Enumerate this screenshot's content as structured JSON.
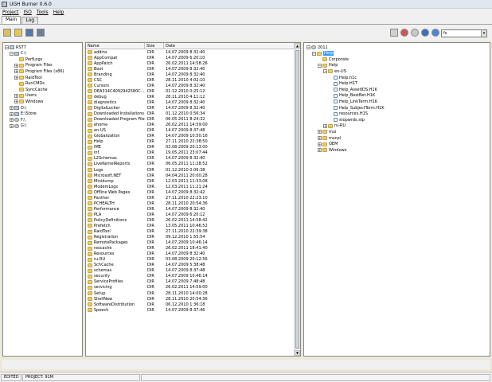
{
  "window": {
    "title": "UGH Burner 0.6.0"
  },
  "menu": [
    "Project",
    "ISO",
    "Tools",
    "Help"
  ],
  "tabs": [
    "Main",
    "Log"
  ],
  "search": {
    "value": "fs"
  },
  "left_tree": [
    {
      "label": "RST7",
      "level": 0,
      "icon": "pc-icon",
      "expander": "minus"
    },
    {
      "label": "C:\\",
      "level": 1,
      "icon": "drive-icon",
      "expander": "minus"
    },
    {
      "label": "PerfLogs",
      "level": 2,
      "icon": "folder-icon",
      "expander": "none"
    },
    {
      "label": "Program Files",
      "level": 2,
      "icon": "folder-icon",
      "expander": "plus"
    },
    {
      "label": "Program Files (x86)",
      "level": 2,
      "icon": "folder-icon",
      "expander": "plus"
    },
    {
      "label": "RaidTool",
      "level": 2,
      "icon": "folder-icon",
      "expander": "plus"
    },
    {
      "label": "RunCMDs",
      "level": 2,
      "icon": "folder-icon",
      "expander": "none"
    },
    {
      "label": "SyncCache",
      "level": 2,
      "icon": "folder-icon",
      "expander": "none"
    },
    {
      "label": "Users",
      "level": 2,
      "icon": "folder-icon",
      "expander": "plus"
    },
    {
      "label": "Windows",
      "level": 2,
      "icon": "folder-icon",
      "expander": "plus"
    },
    {
      "label": "D:\\",
      "level": 1,
      "icon": "drive-icon",
      "expander": "plus"
    },
    {
      "label": "E:\\Store",
      "level": 1,
      "icon": "drive-icon",
      "expander": "plus"
    },
    {
      "label": "F:\\",
      "level": 1,
      "icon": "disc-icon",
      "expander": "plus"
    },
    {
      "label": "G:\\",
      "level": 1,
      "icon": "disc-icon",
      "expander": "plus"
    }
  ],
  "file_list": {
    "columns": [
      "Name",
      "Size",
      "Date"
    ],
    "rows": [
      [
        "addins",
        "DIR",
        "14.07.2009 8:32:40"
      ],
      [
        "AppCompat",
        "DIR",
        "14.07.2009 6:20:10"
      ],
      [
        "AppPatch",
        "DIR",
        "26.02.2011 14:58:26"
      ],
      [
        "Boot",
        "DIR",
        "14.07.2009 8:32:40"
      ],
      [
        "Branding",
        "DIR",
        "14.07.2009 8:32:40"
      ],
      [
        "CSC",
        "DIR",
        "28.11.2010 4:02:10"
      ],
      [
        "Cursors",
        "DIR",
        "14.07.2009 8:32:40"
      ],
      [
        "DEA314C4092942580C...",
        "DIR",
        "01.12.2010 0:25:12"
      ],
      [
        "debug",
        "DIR",
        "28.11.2010 4:11:12"
      ],
      [
        "diagnostics",
        "DIR",
        "14.07.2009 8:32:40"
      ],
      [
        "DigitalLocker",
        "DIR",
        "14.07.2009 8:32:40"
      ],
      [
        "Downloaded Installations",
        "DIR",
        "01.12.2010 0:56:34"
      ],
      [
        "Downloaded Program Files",
        "DIR",
        "06.05.2011 8:24:32"
      ],
      [
        "ehome",
        "DIR",
        "26.02.2011 14:59:00"
      ],
      [
        "en-US",
        "DIR",
        "14.07.2009 8:37:48"
      ],
      [
        "Globalization",
        "DIR",
        "14.07.2009 10:50:16"
      ],
      [
        "Help",
        "DIR",
        "27.11.2010 22:38:50"
      ],
      [
        "IME",
        "DIR",
        "03.08.2009 20:13:00"
      ],
      [
        "inf",
        "DIR",
        "19.05.2011 23:07:44"
      ],
      [
        "L2Schemas",
        "DIR",
        "14.07.2009 8:32:40"
      ],
      [
        "LiveKernelReports",
        "DIR",
        "06.05.2011 11:28:52"
      ],
      [
        "Logs",
        "DIR",
        "01.12.2010 0:06:38"
      ],
      [
        "Microsoft.NET",
        "DIR",
        "04.04.2011 20:00:28"
      ],
      [
        "Minidump",
        "DIR",
        "12.03.2011 11:33:08"
      ],
      [
        "ModemLogs",
        "DIR",
        "12.03.2011 11:21:24"
      ],
      [
        "Offline Web Pages",
        "DIR",
        "14.07.2009 8:32:42"
      ],
      [
        "Panther",
        "DIR",
        "27.11.2010 22:23:10"
      ],
      [
        "PCHEALTH",
        "DIR",
        "28.11.2010 20:54:36"
      ],
      [
        "Performance",
        "DIR",
        "14.07.2009 8:32:40"
      ],
      [
        "PLA",
        "DIR",
        "14.07.2009 6:20:12"
      ],
      [
        "PolicyDefinitions",
        "DIR",
        "26.02.2011 14:58:42"
      ],
      [
        "Prefetch",
        "DIR",
        "13.05.2011 10:46:52"
      ],
      [
        "RaidTool",
        "DIR",
        "27.11.2010 22:39:38"
      ],
      [
        "Registration",
        "DIR",
        "09.12.2010 1:55:54"
      ],
      [
        "RemotePackages",
        "DIR",
        "14.07.2009 10:46:14"
      ],
      [
        "rescache",
        "DIR",
        "26.02.2011 18:41:40"
      ],
      [
        "Resources",
        "DIR",
        "14.07.2009 8:32:40"
      ],
      [
        "ru-RU",
        "DIR",
        "03.08.2009 20:12:56"
      ],
      [
        "SchCache",
        "DIR",
        "14.07.2009 5:38:48"
      ],
      [
        "schemas",
        "DIR",
        "14.07.2009 8:37:48"
      ],
      [
        "security",
        "DIR",
        "14.07.2009 10:46:14"
      ],
      [
        "ServiceProfiles",
        "DIR",
        "14.07.2009 7:48:48"
      ],
      [
        "servicing",
        "DIR",
        "26.02.2011 14:59:00"
      ],
      [
        "Setup",
        "DIR",
        "28.11.2010 14:00:28"
      ],
      [
        "ShellNew",
        "DIR",
        "28.11.2010 20:54:36"
      ],
      [
        "SoftwareDistribution",
        "DIR",
        "06.12.2010 1:36:18"
      ],
      [
        "Speech",
        "DIR",
        "14.07.2009 8:37:46"
      ]
    ]
  },
  "right_tree": [
    {
      "label": "2011",
      "level": 0,
      "icon": "disc-icon",
      "expander": "minus",
      "selected": false
    },
    {
      "label": "Help",
      "level": 1,
      "icon": "folder-icon",
      "expander": "minus",
      "selected": true
    },
    {
      "label": "Corporate",
      "level": 2,
      "icon": "folder-icon",
      "expander": "none",
      "selected": false
    },
    {
      "label": "Help",
      "level": 2,
      "icon": "folder-icon",
      "expander": "minus",
      "selected": false
    },
    {
      "label": "en-US",
      "level": 3,
      "icon": "folder-icon",
      "expander": "minus",
      "selected": false
    },
    {
      "label": "Help.h1c",
      "level": 4,
      "icon": "doc-icon",
      "expander": "none",
      "selected": false
    },
    {
      "label": "Help.H1T",
      "level": 4,
      "icon": "doc-icon",
      "expander": "none",
      "selected": false
    },
    {
      "label": "Help_AssetIDS.H1K",
      "level": 4,
      "icon": "doc-icon",
      "expander": "none",
      "selected": false
    },
    {
      "label": "Help_BestBet.H1K",
      "level": 4,
      "icon": "doc-icon",
      "expander": "none",
      "selected": false
    },
    {
      "label": "Help_LinkTerm.H1K",
      "level": 4,
      "icon": "doc-icon",
      "expander": "none",
      "selected": false
    },
    {
      "label": "Help_SubjectTerm.H1K",
      "level": 4,
      "icon": "doc-icon",
      "expander": "none",
      "selected": false
    },
    {
      "label": "resources.H1S",
      "level": 4,
      "icon": "doc-icon",
      "expander": "none",
      "selected": false
    },
    {
      "label": "stopwrds.stp",
      "level": 4,
      "icon": "doc-icon",
      "expander": "none",
      "selected": false
    },
    {
      "label": "ru-RU",
      "level": 3,
      "icon": "folder-icon",
      "expander": "plus",
      "selected": false
    },
    {
      "label": "mui",
      "level": 2,
      "icon": "folder-icon",
      "expander": "plus",
      "selected": false
    },
    {
      "label": "mxcpl",
      "level": 2,
      "icon": "folder-icon",
      "expander": "plus",
      "selected": false
    },
    {
      "label": "OEM",
      "level": 2,
      "icon": "folder-icon",
      "expander": "plus",
      "selected": false
    },
    {
      "label": "Windows",
      "level": 2,
      "icon": "folder-icon",
      "expander": "plus",
      "selected": false
    }
  ],
  "status": {
    "mode": "EDITED",
    "project": "PROJECT: 91M"
  }
}
